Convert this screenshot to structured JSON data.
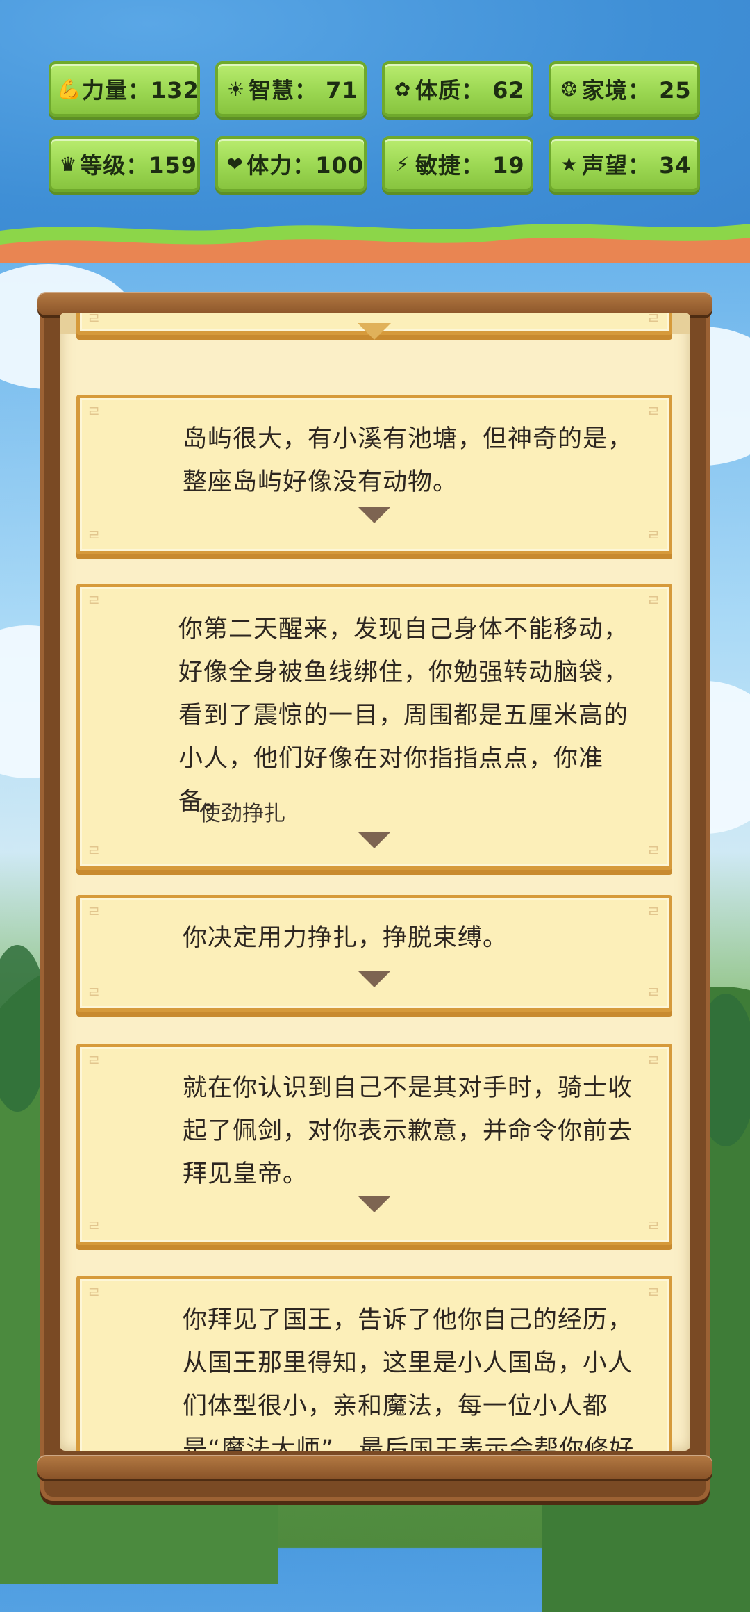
{
  "stats": [
    {
      "icon": "strength-icon",
      "glyph": "💪",
      "label": "力量：132"
    },
    {
      "icon": "wisdom-icon",
      "glyph": "☀",
      "label": "智慧： 71"
    },
    {
      "icon": "constitution-icon",
      "glyph": "✿",
      "label": "体质： 62"
    },
    {
      "icon": "family-icon",
      "glyph": "❂",
      "label": "家境： 25"
    },
    {
      "icon": "level-icon",
      "glyph": "♛",
      "label": "等级：159"
    },
    {
      "icon": "stamina-icon",
      "glyph": "❤",
      "label": "体力：100"
    },
    {
      "icon": "agility-icon",
      "glyph": "⚡",
      "label": "敏捷： 19"
    },
    {
      "icon": "fame-icon",
      "glyph": "★",
      "label": "声望： 34"
    }
  ],
  "story": {
    "cards": [
      {
        "text": "岛屿很大，有小溪有池塘，但神奇的是，整座岛屿好像没有动物。"
      },
      {
        "text": "你第二天醒来，发现自己身体不能移动，好像全身被鱼线绑住，你勉强转动脑袋，看到了震惊的一目，周围都是五厘米高的小人，他们好像在对你指指点点，你准备。",
        "choice": "使劲挣扎"
      },
      {
        "text": "你决定用力挣扎，挣脱束缚。"
      },
      {
        "text": "就在你认识到自己不是其对手时，骑士收起了佩剑，对你表示歉意，并命令你前去拜见皇帝。"
      },
      {
        "text": "你拜见了国王，告诉了他你自己的经历，从国王那里得知，这里是小人国岛，小人们体型很小，亲和魔法，每一位小人都是“魔法大师”，最后国王表示会帮你修好你的船只"
      }
    ]
  }
}
